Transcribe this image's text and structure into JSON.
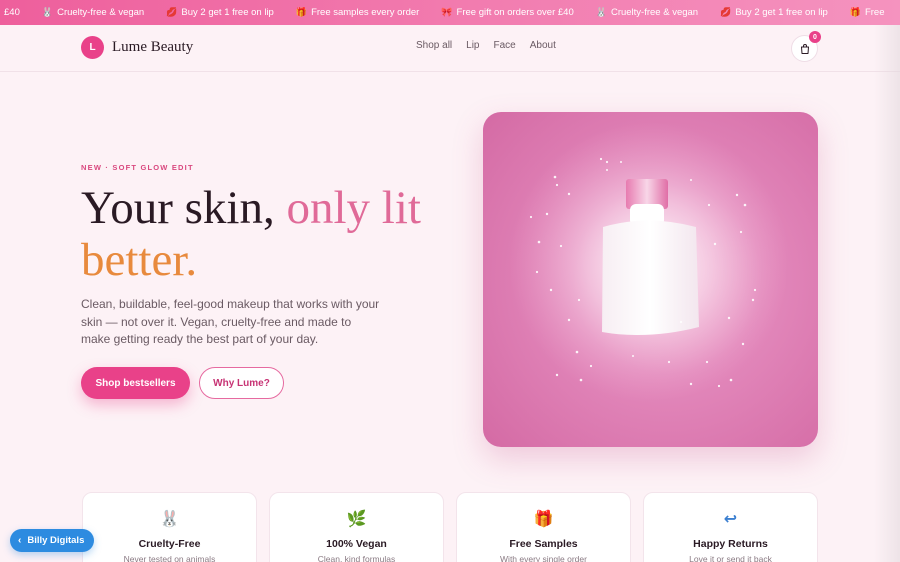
{
  "promo": {
    "items": [
      {
        "icon": "",
        "text": "£40"
      },
      {
        "icon": "bunny-icon",
        "text": "Cruelty-free & vegan"
      },
      {
        "icon": "lips-icon",
        "text": "Buy 2 get 1 free on lip"
      },
      {
        "icon": "gift-icon",
        "text": "Free samples every order"
      },
      {
        "icon": "ribbon-icon",
        "text": "Free gift on orders over £40"
      },
      {
        "icon": "bunny-icon",
        "text": "Cruelty-free & vegan"
      },
      {
        "icon": "lips-icon",
        "text": "Buy 2 get 1 free on lip"
      },
      {
        "icon": "gift-icon",
        "text": "Free"
      }
    ]
  },
  "brand": {
    "initial": "L",
    "name": "Lume Beauty",
    "accent": "#e94189"
  },
  "nav": {
    "items": [
      "Shop all",
      "Lip",
      "Face",
      "About"
    ]
  },
  "cart": {
    "count": "0"
  },
  "hero": {
    "eyebrow": "NEW · SOFT GLOW EDIT",
    "headline_1": "Your skin, ",
    "headline_accent": "only lit",
    "headline_2": "better.",
    "description": "Clean, buildable, feel-good makeup that works with your skin — not over it. Vegan, cruelty-free and made to make getting ready the best part of your day.",
    "primary_cta": "Shop bestsellers",
    "secondary_cta": "Why Lume?"
  },
  "features": [
    {
      "icon": "bunny-icon",
      "glyph": "🐰",
      "title": "Cruelty-Free",
      "subtitle": "Never tested on animals"
    },
    {
      "icon": "leaf-icon",
      "glyph": "🌿",
      "title": "100% Vegan",
      "subtitle": "Clean, kind formulas"
    },
    {
      "icon": "gift-icon",
      "glyph": "🎁",
      "title": "Free Samples",
      "subtitle": "With every single order"
    },
    {
      "icon": "return-icon",
      "glyph": "↩",
      "title": "Happy Returns",
      "subtitle": "Love it or send it back"
    }
  ],
  "chip": {
    "label": "Billy Digitals",
    "color": "#2d8be0"
  }
}
